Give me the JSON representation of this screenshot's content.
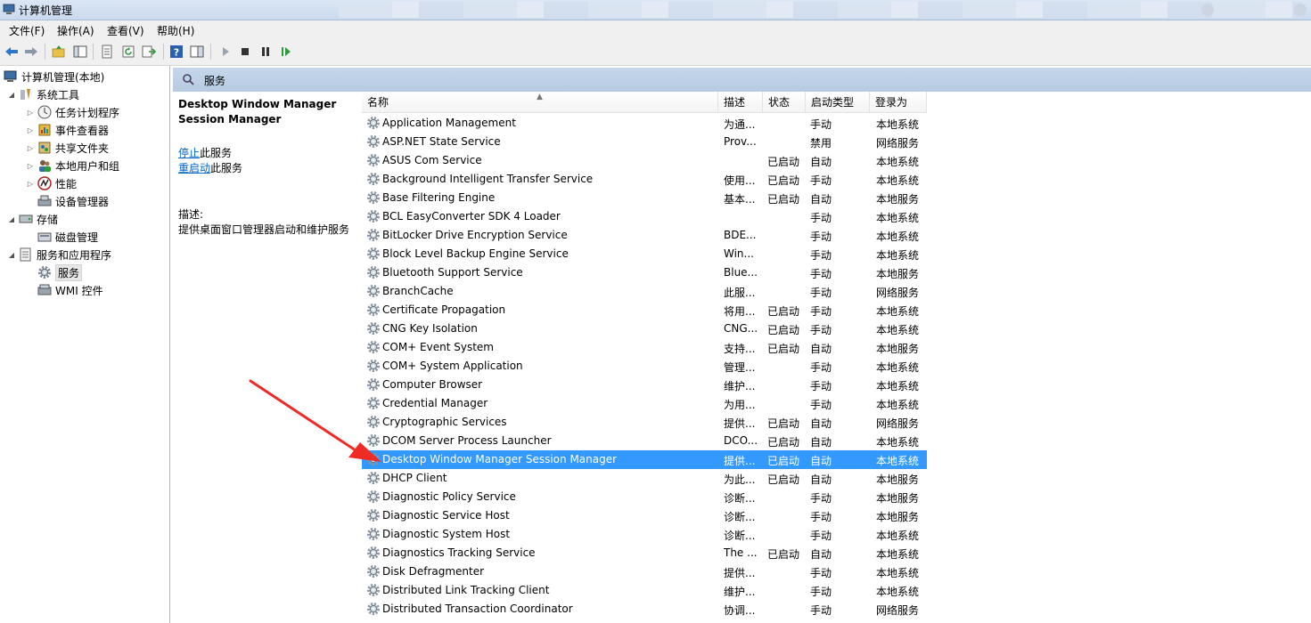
{
  "window": {
    "title": "计算机管理"
  },
  "menu": [
    {
      "label": "文件(F)"
    },
    {
      "label": "操作(A)"
    },
    {
      "label": "查看(V)"
    },
    {
      "label": "帮助(H)"
    }
  ],
  "toolbar": {
    "buttons": [
      {
        "icon": "back-arrow-icon"
      },
      {
        "icon": "forward-arrow-icon"
      },
      {
        "icon": "up-folder-icon"
      },
      {
        "icon": "show-hide-tree-icon"
      },
      {
        "icon": "properties-icon"
      },
      {
        "icon": "refresh-icon"
      },
      {
        "icon": "export-list-icon"
      },
      {
        "icon": "help-icon"
      },
      {
        "icon": "show-action-pane-icon"
      },
      {
        "icon": "play-icon"
      },
      {
        "icon": "stop-icon"
      },
      {
        "icon": "pause-icon"
      },
      {
        "icon": "resume-icon"
      }
    ]
  },
  "tree": [
    {
      "label": "计算机管理(本地)",
      "icon": "computer-management-icon",
      "level": 0,
      "expander": ""
    },
    {
      "label": "系统工具",
      "icon": "system-tools-icon",
      "level": 1,
      "expander": "◢"
    },
    {
      "label": "任务计划程序",
      "icon": "clock-icon",
      "level": 2,
      "expander": "▷"
    },
    {
      "label": "事件查看器",
      "icon": "event-viewer-icon",
      "level": 2,
      "expander": "▷"
    },
    {
      "label": "共享文件夹",
      "icon": "shared-folder-icon",
      "level": 2,
      "expander": "▷"
    },
    {
      "label": "本地用户和组",
      "icon": "users-icon",
      "level": 2,
      "expander": "▷"
    },
    {
      "label": "性能",
      "icon": "performance-icon",
      "level": 2,
      "expander": "▷"
    },
    {
      "label": "设备管理器",
      "icon": "device-manager-icon",
      "level": 2,
      "expander": ""
    },
    {
      "label": "存储",
      "icon": "storage-icon",
      "level": 1,
      "expander": "◢"
    },
    {
      "label": "磁盘管理",
      "icon": "disk-icon",
      "level": 2,
      "expander": ""
    },
    {
      "label": "服务和应用程序",
      "icon": "services-apps-icon",
      "level": 1,
      "expander": "◢"
    },
    {
      "label": "服务",
      "icon": "gear-icon",
      "level": 2,
      "expander": "",
      "selected": true
    },
    {
      "label": "WMI 控件",
      "icon": "wmi-icon",
      "level": 2,
      "expander": ""
    }
  ],
  "panel": {
    "title": "服务",
    "service_name": "Desktop Window Manager Session Manager",
    "stop_link": "停止",
    "stop_suffix": "此服务",
    "restart_link": "重启动",
    "restart_suffix": "此服务",
    "desc_label": "描述:",
    "desc_text": "提供桌面窗口管理器启动和维护服务"
  },
  "columns": {
    "name": "名称",
    "desc": "描述",
    "status": "状态",
    "startup": "启动类型",
    "logon": "登录为"
  },
  "rows": [
    {
      "name": "Application Management",
      "desc": "为通...",
      "status": "",
      "startup": "手动",
      "logon": "本地系统"
    },
    {
      "name": "ASP.NET State Service",
      "desc": "Prov...",
      "status": "",
      "startup": "禁用",
      "logon": "网络服务"
    },
    {
      "name": "ASUS Com Service",
      "desc": "",
      "status": "已启动",
      "startup": "自动",
      "logon": "本地系统"
    },
    {
      "name": "Background Intelligent Transfer Service",
      "desc": "使用...",
      "status": "已启动",
      "startup": "手动",
      "logon": "本地系统"
    },
    {
      "name": "Base Filtering Engine",
      "desc": "基本...",
      "status": "已启动",
      "startup": "自动",
      "logon": "本地服务"
    },
    {
      "name": "BCL EasyConverter SDK 4 Loader",
      "desc": "",
      "status": "",
      "startup": "手动",
      "logon": "本地系统"
    },
    {
      "name": "BitLocker Drive Encryption Service",
      "desc": "BDE...",
      "status": "",
      "startup": "手动",
      "logon": "本地系统"
    },
    {
      "name": "Block Level Backup Engine Service",
      "desc": "Win...",
      "status": "",
      "startup": "手动",
      "logon": "本地系统"
    },
    {
      "name": "Bluetooth Support Service",
      "desc": "Blue...",
      "status": "",
      "startup": "手动",
      "logon": "本地服务"
    },
    {
      "name": "BranchCache",
      "desc": "此服...",
      "status": "",
      "startup": "手动",
      "logon": "网络服务"
    },
    {
      "name": "Certificate Propagation",
      "desc": "将用...",
      "status": "已启动",
      "startup": "手动",
      "logon": "本地系统"
    },
    {
      "name": "CNG Key Isolation",
      "desc": "CNG...",
      "status": "已启动",
      "startup": "手动",
      "logon": "本地系统"
    },
    {
      "name": "COM+ Event System",
      "desc": "支持...",
      "status": "已启动",
      "startup": "自动",
      "logon": "本地服务"
    },
    {
      "name": "COM+ System Application",
      "desc": "管理...",
      "status": "",
      "startup": "手动",
      "logon": "本地系统"
    },
    {
      "name": "Computer Browser",
      "desc": "维护...",
      "status": "",
      "startup": "手动",
      "logon": "本地系统"
    },
    {
      "name": "Credential Manager",
      "desc": "为用...",
      "status": "",
      "startup": "手动",
      "logon": "本地系统"
    },
    {
      "name": "Cryptographic Services",
      "desc": "提供...",
      "status": "已启动",
      "startup": "自动",
      "logon": "网络服务"
    },
    {
      "name": "DCOM Server Process Launcher",
      "desc": "DCO...",
      "status": "已启动",
      "startup": "自动",
      "logon": "本地系统"
    },
    {
      "name": "Desktop Window Manager Session Manager",
      "desc": "提供...",
      "status": "已启动",
      "startup": "自动",
      "logon": "本地系统",
      "selected": true
    },
    {
      "name": "DHCP Client",
      "desc": "为此...",
      "status": "已启动",
      "startup": "自动",
      "logon": "本地服务"
    },
    {
      "name": "Diagnostic Policy Service",
      "desc": "诊断...",
      "status": "",
      "startup": "手动",
      "logon": "本地服务"
    },
    {
      "name": "Diagnostic Service Host",
      "desc": "诊断...",
      "status": "",
      "startup": "手动",
      "logon": "本地服务"
    },
    {
      "name": "Diagnostic System Host",
      "desc": "诊断...",
      "status": "",
      "startup": "手动",
      "logon": "本地系统"
    },
    {
      "name": "Diagnostics Tracking Service",
      "desc": "The ...",
      "status": "已启动",
      "startup": "自动",
      "logon": "本地系统"
    },
    {
      "name": "Disk Defragmenter",
      "desc": "提供...",
      "status": "",
      "startup": "手动",
      "logon": "本地系统"
    },
    {
      "name": "Distributed Link Tracking Client",
      "desc": "维护...",
      "status": "",
      "startup": "手动",
      "logon": "本地系统"
    },
    {
      "name": "Distributed Transaction Coordinator",
      "desc": "协调...",
      "status": "",
      "startup": "手动",
      "logon": "网络服务"
    }
  ],
  "colors": {
    "selection": "#3399ff",
    "link": "#0066cc",
    "annotation": "#ee2b24"
  }
}
